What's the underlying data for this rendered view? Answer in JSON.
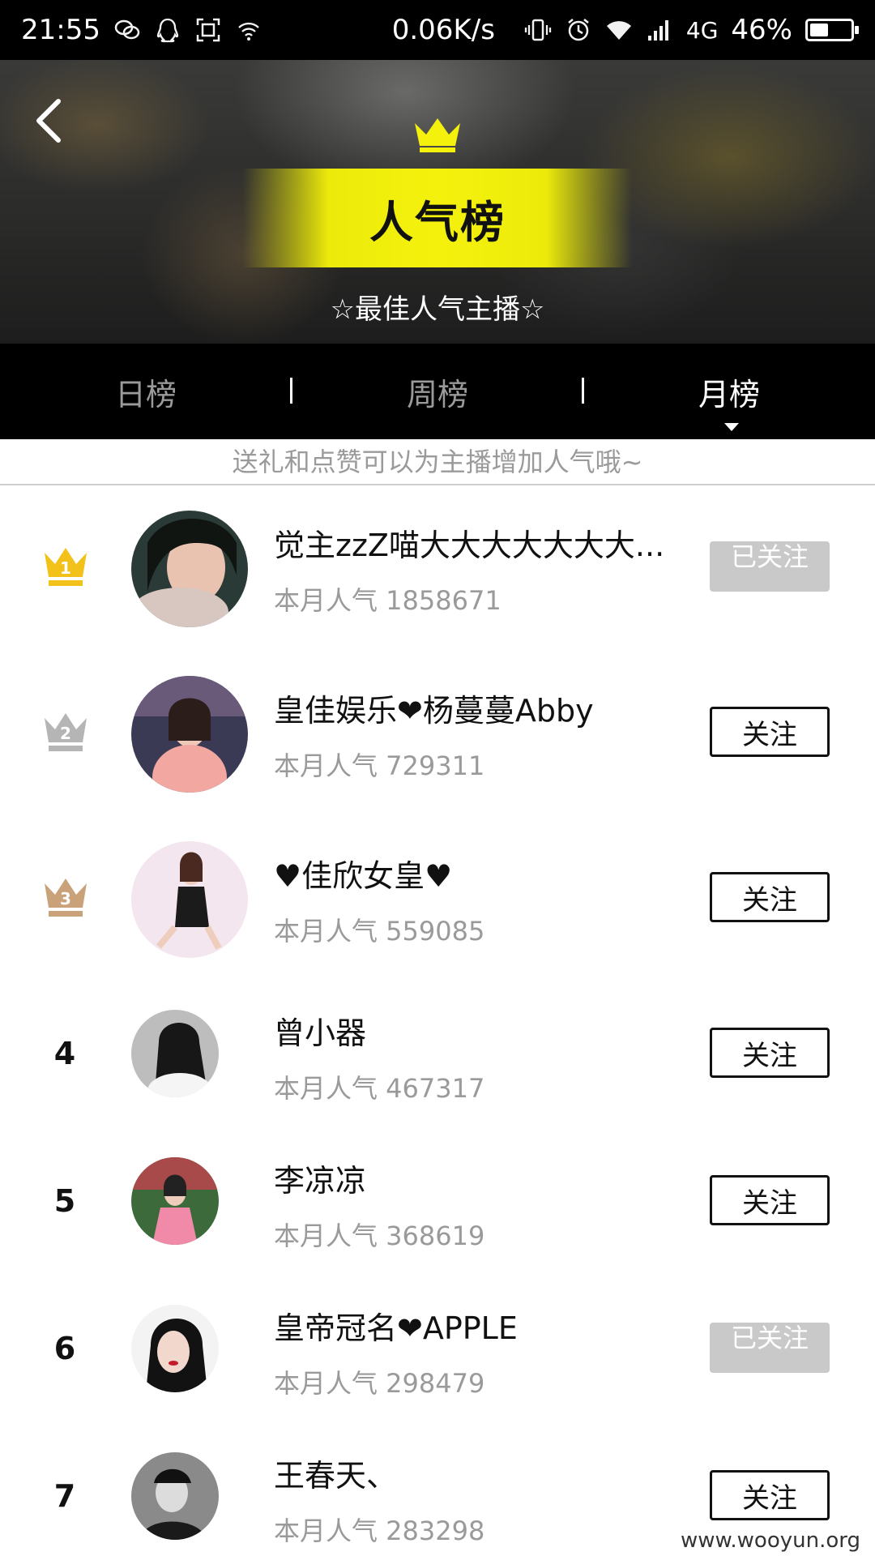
{
  "status_bar": {
    "time": "21:55",
    "net_speed": "0.06K/s",
    "network": "4G",
    "battery": "46%",
    "battery_level": 0.46,
    "icons": [
      "chat-icon",
      "qq-icon",
      "scan-icon",
      "wifi-small-icon",
      "vibrate-icon",
      "alarm-icon",
      "wifi-icon",
      "signal-icon"
    ]
  },
  "header": {
    "back_icon": "chevron-left-icon",
    "crown_icon": "crown-icon",
    "title": "人气榜",
    "subtitle": "☆最佳人气主播☆",
    "accent_color": "#f4f20c"
  },
  "tabs": [
    {
      "label": "日榜",
      "active": false
    },
    {
      "label": "周榜",
      "active": false
    },
    {
      "label": "月榜",
      "active": true
    }
  ],
  "hint": "送礼和点赞可以为主播增加人气哦~",
  "rows": [
    {
      "rank": "1",
      "crown": "gold",
      "name": "觉主zzZ喵大大大大大大大...",
      "popularity": "本月人气 1858671",
      "button": "已关注",
      "followed": true
    },
    {
      "rank": "2",
      "crown": "silver",
      "name": "皇佳娱乐❤杨蔓蔓Abby",
      "popularity": "本月人气 729311",
      "button": "关注",
      "followed": false
    },
    {
      "rank": "3",
      "crown": "bronze",
      "name": "♥佳欣女皇♥",
      "popularity": "本月人气 559085",
      "button": "关注",
      "followed": false
    },
    {
      "rank": "4",
      "crown": "",
      "name": "曾小器",
      "popularity": "本月人气 467317",
      "button": "关注",
      "followed": false
    },
    {
      "rank": "5",
      "crown": "",
      "name": "李凉凉",
      "popularity": "本月人气 368619",
      "button": "关注",
      "followed": false
    },
    {
      "rank": "6",
      "crown": "",
      "name": "皇帝冠名❤APPLE",
      "popularity": "本月人气 298479",
      "button": "已关注",
      "followed": true
    },
    {
      "rank": "7",
      "crown": "",
      "name": "王春天、",
      "popularity": "本月人气 283298",
      "button": "关注",
      "followed": false
    }
  ],
  "colors": {
    "gold": "#f2c21a",
    "silver": "#b5b5b5",
    "bronze": "#c9a27a",
    "followed_bg": "#c9c9c9"
  },
  "watermark": "www.wooyun.org"
}
